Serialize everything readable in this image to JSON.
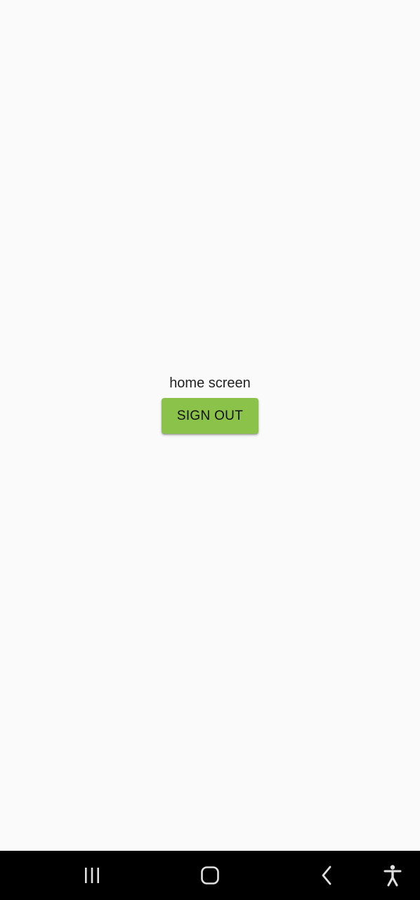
{
  "main": {
    "label": "home screen",
    "sign_out_label": "SIGN OUT"
  },
  "colors": {
    "background": "#fafafa",
    "button": "#8bc34a",
    "navbar": "#000000",
    "nav_icon": "#e0e0e0"
  },
  "navbar": {
    "icons": [
      "recent-apps-icon",
      "home-icon",
      "back-icon",
      "accessibility-icon"
    ]
  }
}
